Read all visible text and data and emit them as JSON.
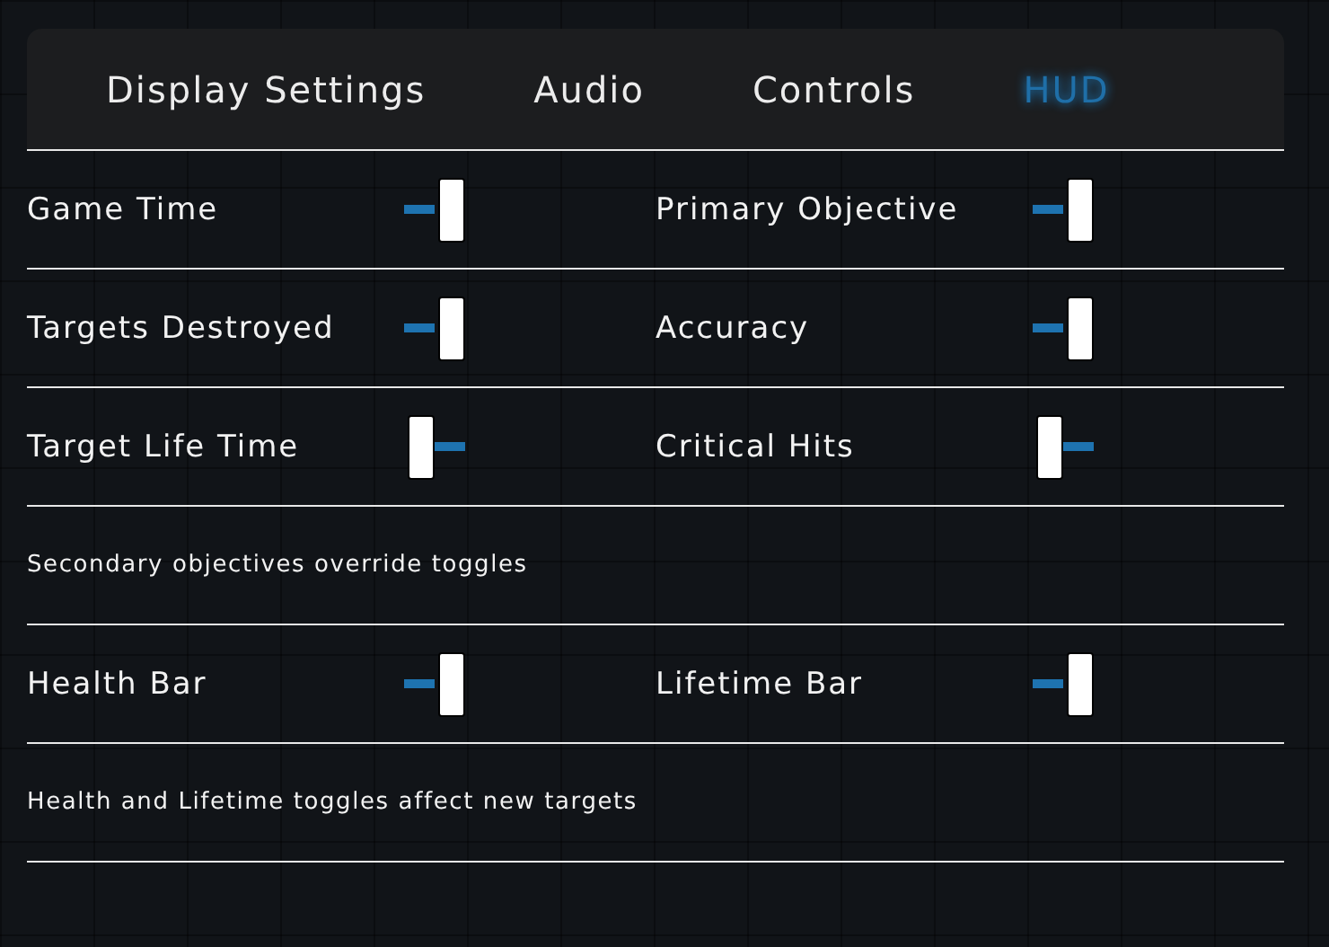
{
  "tabs": [
    {
      "label": "Display Settings",
      "selected": false
    },
    {
      "label": "Audio",
      "selected": false
    },
    {
      "label": "Controls",
      "selected": false
    },
    {
      "label": "HUD",
      "selected": true
    }
  ],
  "sections": [
    {
      "kind": "toggles",
      "items": [
        {
          "label": "Game Time",
          "on": true
        },
        {
          "label": "Primary Objective",
          "on": true
        }
      ]
    },
    {
      "kind": "toggles",
      "items": [
        {
          "label": "Targets Destroyed",
          "on": true
        },
        {
          "label": "Accuracy",
          "on": true
        }
      ]
    },
    {
      "kind": "toggles",
      "items": [
        {
          "label": "Target Life Time",
          "on": false
        },
        {
          "label": "Critical Hits",
          "on": false
        }
      ]
    },
    {
      "kind": "note",
      "text": "Secondary objectives override toggles"
    },
    {
      "kind": "toggles",
      "items": [
        {
          "label": "Health Bar",
          "on": true
        },
        {
          "label": "Lifetime Bar",
          "on": true
        }
      ]
    },
    {
      "kind": "note",
      "text": "Health and Lifetime toggles affect new targets"
    }
  ]
}
